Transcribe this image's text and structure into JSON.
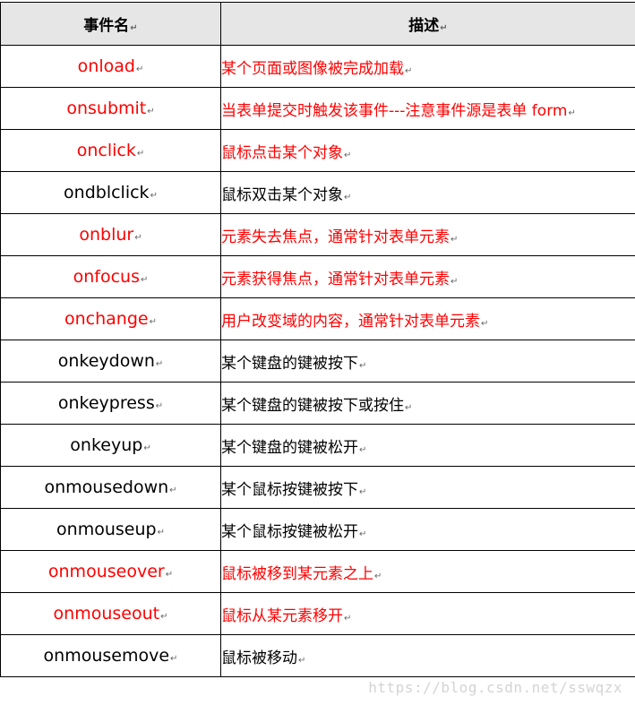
{
  "table": {
    "headers": {
      "name": "事件名",
      "description": "描述"
    },
    "paragraph_mark": "↵",
    "rows": [
      {
        "name": "onload",
        "description": "某个页面或图像被完成加载",
        "highlighted": true
      },
      {
        "name": "onsubmit",
        "description": "当表单提交时触发该事件---注意事件源是表单 form",
        "highlighted": true
      },
      {
        "name": "onclick",
        "description": "鼠标点击某个对象",
        "highlighted": true
      },
      {
        "name": "ondblclick",
        "description": "鼠标双击某个对象",
        "highlighted": false
      },
      {
        "name": "onblur",
        "description": "元素失去焦点，通常针对表单元素",
        "highlighted": true
      },
      {
        "name": "onfocus",
        "description": "元素获得焦点，通常针对表单元素",
        "highlighted": true
      },
      {
        "name": "onchange",
        "description": "用户改变域的内容，通常针对表单元素",
        "highlighted": true
      },
      {
        "name": "onkeydown",
        "description": "某个键盘的键被按下",
        "highlighted": false
      },
      {
        "name": "onkeypress",
        "description": "某个键盘的键被按下或按住",
        "highlighted": false
      },
      {
        "name": "onkeyup",
        "description": "某个键盘的键被松开",
        "highlighted": false
      },
      {
        "name": "onmousedown",
        "description": "某个鼠标按键被按下",
        "highlighted": false
      },
      {
        "name": "onmouseup",
        "description": "某个鼠标按键被松开",
        "highlighted": false
      },
      {
        "name": "onmouseover",
        "description": "鼠标被移到某元素之上",
        "highlighted": true
      },
      {
        "name": "onmouseout",
        "description": "鼠标从某元素移开",
        "highlighted": true
      },
      {
        "name": "onmousemove",
        "description": "鼠标被移动",
        "highlighted": false
      }
    ]
  },
  "colors": {
    "highlight": "#ff0000",
    "normal": "#000000",
    "header_background": "#e7e6e6"
  },
  "watermark": "https://blog.csdn.net/sswqzx"
}
